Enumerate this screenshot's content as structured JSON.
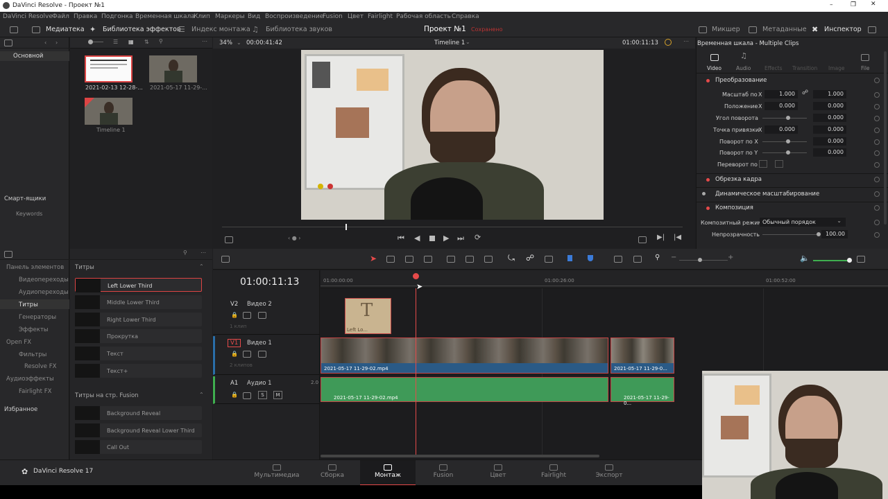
{
  "window": {
    "title": "DaVinci Resolve - Проект №1"
  },
  "menu": [
    "DaVinci Resolve",
    "Файл",
    "Правка",
    "Подгонка",
    "Временная шкала",
    "Клип",
    "Маркеры",
    "Вид",
    "Воспроизведение",
    "Fusion",
    "Цвет",
    "Fairlight",
    "Рабочая область",
    "Справка"
  ],
  "toolbar": {
    "media": "Медиатека",
    "effects": "Библиотека эффектов",
    "edit_index": "Индекс монтажа",
    "sound_lib": "Библиотека звуков",
    "project": "Проект №1",
    "saved": "Сохранено",
    "mixer": "Микшер",
    "metadata": "Метаданные",
    "inspector": "Инспектор"
  },
  "media_left": {
    "bin": "Основной",
    "smart_bins": "Смарт-ящики",
    "keywords": "Keywords"
  },
  "media_items": [
    {
      "label": "2021-02-13 12-28-..."
    },
    {
      "label": "2021-05-17 11-29-..."
    },
    {
      "label": "Timeline 1"
    }
  ],
  "viewer": {
    "zoom": "34%",
    "duration": "00:00:41:42",
    "timeline_name": "Timeline 1",
    "timecode": "01:00:11:13"
  },
  "inspector": {
    "title": "Временная шкала - Multiple Clips",
    "tabs": [
      "Video",
      "Audio",
      "Effects",
      "Transition",
      "Image",
      "File"
    ],
    "transform": "Преобразование",
    "rows": [
      {
        "label": "Масштаб по",
        "x": "1.000",
        "y": "1.000"
      },
      {
        "label": "Положение",
        "x": "0.000",
        "y": "0.000"
      },
      {
        "label": "Угол поворота",
        "v": "0.000"
      },
      {
        "label": "Точка привязки",
        "x": "0.000",
        "y": "0.000"
      },
      {
        "label": "Поворот по X",
        "v": "0.000"
      },
      {
        "label": "Поворот по Y",
        "v": "0.000"
      },
      {
        "label": "Переворот по"
      }
    ],
    "crop": "Обрезка кадра",
    "dynzoom": "Динамическое масштабирование",
    "composite": "Композиция",
    "composite_mode_label": "Композитный режим",
    "composite_mode": "Обычный порядок",
    "opacity_label": "Непрозрачность",
    "opacity": "100.00"
  },
  "fx_left": {
    "items": [
      "Панель элементов",
      "Видеопереходы",
      "Аудиопереходы",
      "Титры",
      "Генераторы",
      "Эффекты",
      "Open FX",
      "Фильтры",
      "Resolve FX",
      "Аудиоэффекты",
      "Fairlight FX"
    ],
    "favorites": "Избранное"
  },
  "fx_list": {
    "titles_header": "Титры",
    "titles": [
      "Left Lower Third",
      "Middle Lower Third",
      "Right Lower Third",
      "Прокрутка",
      "Текст",
      "Текст+"
    ],
    "fusion_header": "Титры на стр. Fusion",
    "fusion": [
      "Background Reveal",
      "Background Reveal Lower Third",
      "Call Out"
    ]
  },
  "timeline": {
    "timecode": "01:00:11:13",
    "ruler": [
      "01:00:00:00",
      "01:00:26:00",
      "01:00:52:00"
    ],
    "tracks": [
      {
        "id": "V2",
        "name": "Видео 2",
        "count": "1 клип"
      },
      {
        "id": "V1",
        "name": "Видео 1",
        "count": "2 клипов"
      },
      {
        "id": "A1",
        "name": "Аудио 1",
        "level": "2.0"
      }
    ],
    "title_clip": "Left Lo...",
    "clip1": "2021-05-17 11-29-02.mp4",
    "clip2": "2021-05-17 11-29-0..."
  },
  "pages": [
    "Мультимедиа",
    "Сборка",
    "Монтаж",
    "Fusion",
    "Цвет",
    "Fairlight",
    "Экспорт"
  ],
  "brand": "DaVinci Resolve 17",
  "colors": {
    "accent": "#e64a4a",
    "audio": "#3f9a58",
    "video": "#2a5a86"
  }
}
